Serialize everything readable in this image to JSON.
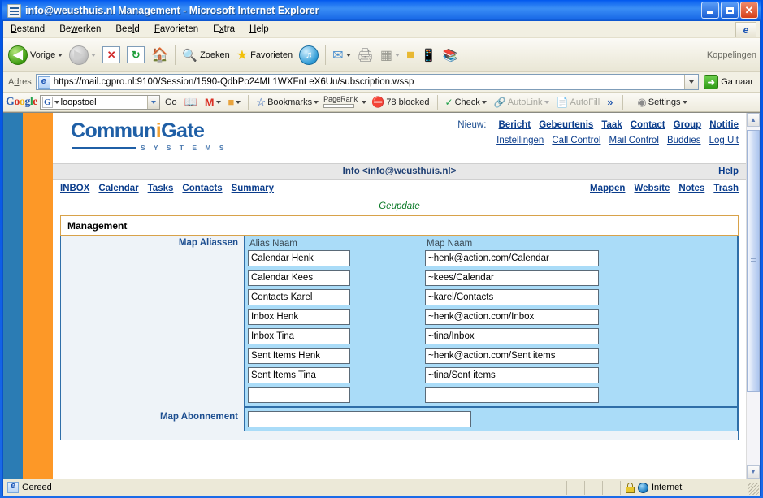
{
  "window": {
    "title": "info@weusthuis.nl Management - Microsoft Internet Explorer",
    "icon": "document-icon",
    "minimize_label": "Minimize",
    "maximize_label": "Maximize",
    "close_label": "Close"
  },
  "menubar": {
    "items": [
      {
        "label": "Bestand",
        "accel": "B"
      },
      {
        "label": "Bewerken",
        "accel": "w"
      },
      {
        "label": "Beeld",
        "accel": "l"
      },
      {
        "label": "Favorieten",
        "accel": "F"
      },
      {
        "label": "Extra",
        "accel": "x"
      },
      {
        "label": "Help",
        "accel": "H"
      }
    ]
  },
  "toolbar": {
    "back_label": "Vorige",
    "forward_label": "",
    "stop_label": "Stop",
    "refresh_label": "Refresh",
    "home_label": "Home",
    "search_label": "Zoeken",
    "favorites_label": "Favorieten",
    "media_label": "Media",
    "mail_label": "Mail",
    "print_label": "Print",
    "edit_label": "Edit",
    "discuss_label": "Discuss",
    "messenger_label": "Messenger",
    "research_label": "Research",
    "links_label": "Koppelingen"
  },
  "addressbar": {
    "label": "Adres",
    "url": "https://mail.cgpro.nl:9100/Session/1590-QdbPo24ML1WXFnLeX6Uu/subscription.wssp",
    "go_label": "Ga naar"
  },
  "googlebar": {
    "logo": "Google",
    "query": "loopstoel",
    "go_label": "Go",
    "bookmarks_label": "Bookmarks",
    "pagerank_label": "PageRank",
    "blocked_label": "78 blocked",
    "check_label": "Check",
    "autolink_label": "AutoLink",
    "autofill_label": "AutoFill",
    "more_label": "»",
    "settings_label": "Settings"
  },
  "page": {
    "logo": {
      "name": "CommuniGate",
      "tagline": "S Y S T E M S"
    },
    "new_label": "Nieuw:",
    "new_links": [
      "Bericht",
      "Gebeurtenis",
      "Taak",
      "Contact",
      "Group",
      "Notitie"
    ],
    "account_links": [
      "Instellingen",
      "Call Control",
      "Mail Control",
      "Buddies",
      "Log Uit"
    ],
    "infobar": {
      "account": "Info <info@weusthuis.nl>",
      "help": "Help"
    },
    "nav_left": [
      "INBOX",
      "Calendar",
      "Tasks",
      "Contacts",
      "Summary"
    ],
    "nav_right": [
      "Mappen",
      "Website",
      "Notes",
      "Trash"
    ],
    "status_message": "Geupdate",
    "panel_title": "Management",
    "form": {
      "aliases_label": "Map Aliassen",
      "col_alias": "Alias Naam",
      "col_folder": "Map Naam",
      "rows": [
        {
          "alias": "Calendar Henk",
          "folder": "~henk@action.com/Calendar"
        },
        {
          "alias": "Calendar Kees",
          "folder": "~kees/Calendar"
        },
        {
          "alias": "Contacts Karel",
          "folder": "~karel/Contacts"
        },
        {
          "alias": "Inbox Henk",
          "folder": "~henk@action.com/Inbox"
        },
        {
          "alias": "Inbox Tina",
          "folder": "~tina/Inbox"
        },
        {
          "alias": "Sent Items Henk",
          "folder": "~henk@action.com/Sent items"
        },
        {
          "alias": "Sent Items Tina",
          "folder": "~tina/Sent items"
        },
        {
          "alias": "",
          "folder": ""
        }
      ],
      "subscription_label": "Map Abonnement",
      "subscription_value": ""
    }
  },
  "statusbar": {
    "text": "Gereed",
    "zone": "Internet",
    "secure_icon": "lock-icon"
  },
  "colors": {
    "brand_blue": "#1f5fa6",
    "brand_orange": "#fd9827",
    "stripe_blue": "#2b7cb4",
    "field_bg": "#aadcf8",
    "panel_bg": "#eef3f8",
    "status_green": "#0c7a29",
    "link_blue": "#0b3d8c"
  }
}
